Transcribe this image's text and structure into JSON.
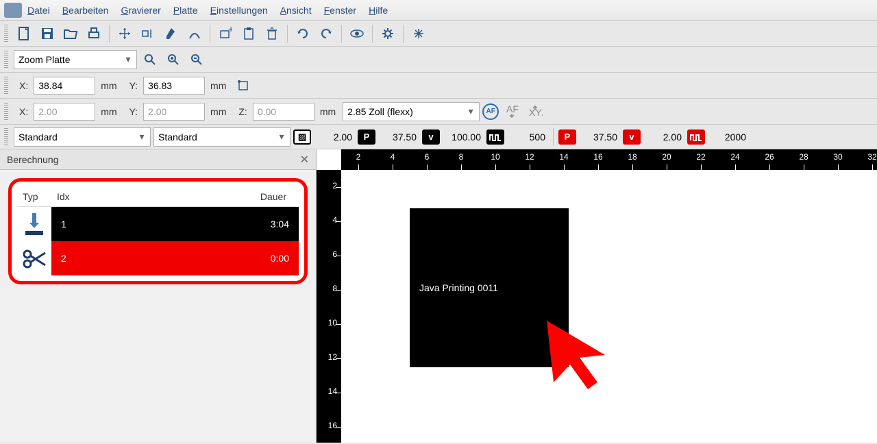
{
  "menu": [
    "Datei",
    "Bearbeiten",
    "Gravierer",
    "Platte",
    "Einstellungen",
    "Ansicht",
    "Fenster",
    "Hilfe"
  ],
  "zoom_combo": "Zoom Platte",
  "coords1": {
    "x_label": "X:",
    "x": "38.84",
    "x_unit": "mm",
    "y_label": "Y:",
    "y": "36.83",
    "y_unit": "mm"
  },
  "coords2": {
    "x_label": "X:",
    "x": "2.00",
    "x_unit": "mm",
    "y_label": "Y:",
    "y": "2.00",
    "y_unit": "mm",
    "z_label": "Z:",
    "z": "0.00",
    "z_unit": "mm",
    "material": "2.85 Zoll (flexx)",
    "af": "AF"
  },
  "layer_combo1": "Standard",
  "layer_combo2": "Standard",
  "params_black": {
    "v1": "2.00",
    "p": "P",
    "v2": "37.50",
    "v": "v",
    "v3": "100.00",
    "hz": "500"
  },
  "params_red": {
    "p": "P",
    "v1": "37.50",
    "v": "v",
    "v2": "2.00",
    "hz": "2000"
  },
  "panel": {
    "title": "Berechnung",
    "headers": {
      "typ": "Typ",
      "idx": "Idx",
      "dauer": "Dauer"
    },
    "rows": [
      {
        "idx": "1",
        "dauer": "3:04"
      },
      {
        "idx": "2",
        "dauer": "0:00"
      }
    ]
  },
  "ruler_h": [
    "2",
    "4",
    "6",
    "8",
    "10",
    "12",
    "14",
    "16",
    "18",
    "20",
    "22",
    "24",
    "26",
    "28",
    "30",
    "32"
  ],
  "ruler_v": [
    "2",
    "4",
    "6",
    "8",
    "10",
    "12",
    "14",
    "16"
  ],
  "canvas_text": "Java Printing 0011"
}
